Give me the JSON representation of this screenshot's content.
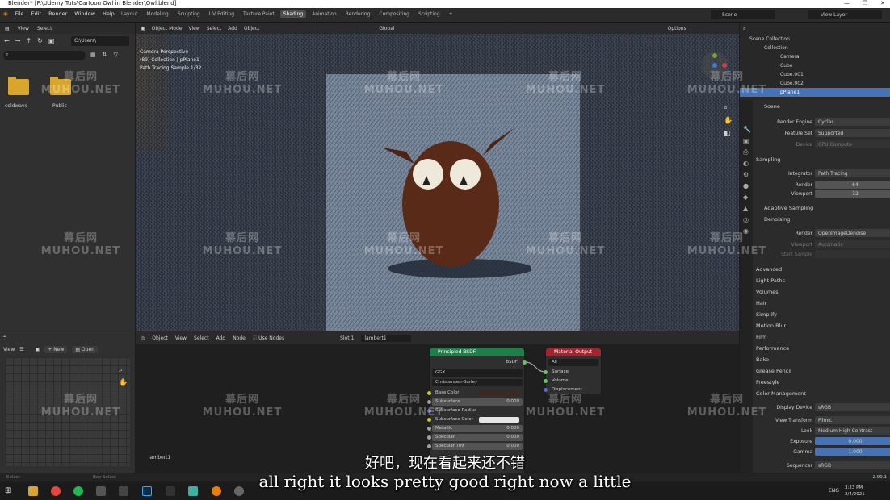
{
  "window": {
    "title": "Blender* [F:\\Udemy Tuts\\Cartoon Owl in Blender\\Owl.blend]"
  },
  "menu": [
    "File",
    "Edit",
    "Render",
    "Window",
    "Help"
  ],
  "workspaces": [
    "Layout",
    "Modeling",
    "Sculpting",
    "UV Editing",
    "Texture Paint",
    "Shading",
    "Animation",
    "Rendering",
    "Compositing",
    "Scripting"
  ],
  "active_workspace": "Shading",
  "scene_name": "Scene",
  "view_layer": "View Layer",
  "file_browser": {
    "menu": [
      "View",
      "Select"
    ],
    "path": "C:\\Users\\",
    "folders": [
      "coldwave",
      "Public"
    ]
  },
  "viewport": {
    "mode": "Object Mode",
    "menu": [
      "View",
      "Select",
      "Add",
      "Object"
    ],
    "transform": "Global",
    "options": "Options",
    "info": [
      "Camera Perspective",
      "(89) Collection | pPlane1",
      "Path Tracing Sample 1/32"
    ]
  },
  "outliner": {
    "root": "Scene Collection",
    "items": [
      "Collection",
      "Camera",
      "Cube",
      "Cube.001",
      "Cube.002",
      "pPlane1"
    ]
  },
  "properties": {
    "scene_label": "Scene",
    "render_engine_label": "Render Engine",
    "render_engine": "Cycles",
    "feature_set_label": "Feature Set",
    "feature_set": "Supported",
    "device_label": "Device",
    "device": "GPU Compute",
    "sampling": "Sampling",
    "integrator_label": "Integrator",
    "integrator": "Path Tracing",
    "render_label": "Render",
    "render_samples": "64",
    "viewport_label": "Viewport",
    "viewport_samples": "32",
    "adaptive_sampling": "Adaptive Sampling",
    "denoising": "Denoising",
    "denoise_render_label": "Render",
    "denoiser": "OpenImageDenoise",
    "denoise_viewport_label": "Viewport",
    "denoise_viewport": "Automatic",
    "start_sample_label": "Start Sample",
    "panels": [
      "Advanced",
      "Light Paths",
      "Volumes",
      "Hair",
      "Simplify",
      "Motion Blur",
      "Film",
      "Performance",
      "Bake",
      "Grease Pencil",
      "Freestyle",
      "Color Management"
    ],
    "display_device_label": "Display Device",
    "display_device": "sRGB",
    "view_transform_label": "View Transform",
    "view_transform": "Filmic",
    "look_label": "Look",
    "look": "Medium High Contrast",
    "exposure_label": "Exposure",
    "exposure": "0.000",
    "gamma_label": "Gamma",
    "gamma": "1.000",
    "sequencer_label": "Sequencer",
    "sequencer": "sRGB"
  },
  "uv_editor": {
    "view": "View",
    "new": "New",
    "open": "Open"
  },
  "node_editor": {
    "mode": "Object",
    "menu": [
      "View",
      "Select",
      "Add",
      "Node"
    ],
    "use_nodes": "Use Nodes",
    "slot": "Slot 1",
    "material": "lambert1",
    "label": "lambert1",
    "bsdf": {
      "title": "Principled BSDF",
      "output": "BSDF",
      "distribution": "GGX",
      "subsurface_method": "Christensen-Burley",
      "rows": [
        {
          "name": "Base Color",
          "value": ""
        },
        {
          "name": "Subsurface",
          "value": "0.000"
        },
        {
          "name": "Subsurface Radius",
          "value": ""
        },
        {
          "name": "Subsurface Color",
          "value": ""
        },
        {
          "name": "Metallic",
          "value": "0.000"
        },
        {
          "name": "Specular",
          "value": "0.000"
        },
        {
          "name": "Specular Tint",
          "value": "0.000"
        }
      ]
    },
    "output": {
      "title": "Material Output",
      "target": "All",
      "inputs": [
        "Surface",
        "Volume",
        "Displacement"
      ]
    }
  },
  "statusbar": {
    "left": "Select",
    "mid": "Box Select",
    "right": "2.90.1"
  },
  "taskbar": {
    "lang": "ENG",
    "time": "3:23 PM",
    "date": "2/4/2021"
  },
  "subtitles": {
    "cn": "好吧，现在看起来还不错",
    "en": "all right it looks pretty good right now a little"
  },
  "watermark": {
    "cn": "幕后网",
    "en": "MUHOU.NET"
  },
  "colors": {
    "bsdf_header": "#1e7f48",
    "output_header": "#a2242f",
    "selection": "#4772b3",
    "folder": "#d9a62c"
  }
}
